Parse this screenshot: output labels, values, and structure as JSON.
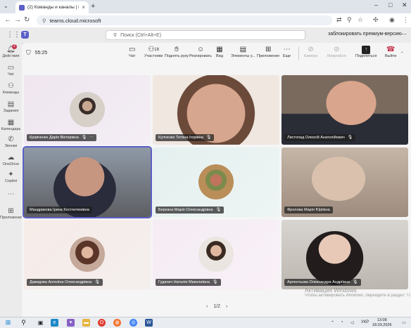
{
  "browser": {
    "tab_title": "(2) Команды и каналы | B...",
    "url": "teams.cloud.microsoft"
  },
  "teams": {
    "search_placeholder": "Поиск (Ctrl+Alt+E)",
    "premium_text": "заблокировать премиум-версию"
  },
  "rail": [
    {
      "label": "Действия",
      "icon": "bell-icon",
      "badge": "2"
    },
    {
      "label": "Чат",
      "icon": "chat-icon"
    },
    {
      "label": "Команды",
      "icon": "teams-icon"
    },
    {
      "label": "Задания",
      "icon": "assignments-icon"
    },
    {
      "label": "Календарь",
      "icon": "calendar-icon"
    },
    {
      "label": "Звонки",
      "icon": "phone-icon"
    },
    {
      "label": "OneDrive",
      "icon": "cloud-icon"
    },
    {
      "label": "Copilot",
      "icon": "copilot-icon"
    },
    {
      "label": "Приложения",
      "icon": "apps-icon"
    }
  ],
  "meeting": {
    "timer": "55:25",
    "controls": {
      "chat": "Чат",
      "participants": "Участники",
      "participants_count": "18",
      "raise_hand": "Поднять руку",
      "react": "Реагировать",
      "view": "Вид",
      "elements": "Элементы у...",
      "apps": "Приложение",
      "more": "Еще",
      "camera": "Камера",
      "mic": "Микрофон",
      "share": "Поделиться",
      "leave": "Выйти"
    },
    "participants": [
      {
        "name": "Кравченко Дарія Вікторівна"
      },
      {
        "name": "Кулченко Тетяна Ігорівна"
      },
      {
        "name": "Листопад Олексій Анатолійович"
      },
      {
        "name": "Мандрикова Ірина Костянтинівна"
      },
      {
        "name": "Березна Марія Олександрівна"
      },
      {
        "name": "Фролова Марія Юріївна"
      },
      {
        "name": "Давидова Ангеліна Олександрівна"
      },
      {
        "name": "Гудачич Наталія Миколаївна"
      },
      {
        "name": "Арлентьєва Олександра Андріївна"
      }
    ],
    "pager": "1/2",
    "watermark_line1": "Активация Windows",
    "watermark_line2": "Чтобы активировать Windows, перейдите в раздел \"Параметры\"."
  },
  "taskbar": {
    "lang": "УКР",
    "time": "13:08",
    "date": "18.03.2026"
  }
}
